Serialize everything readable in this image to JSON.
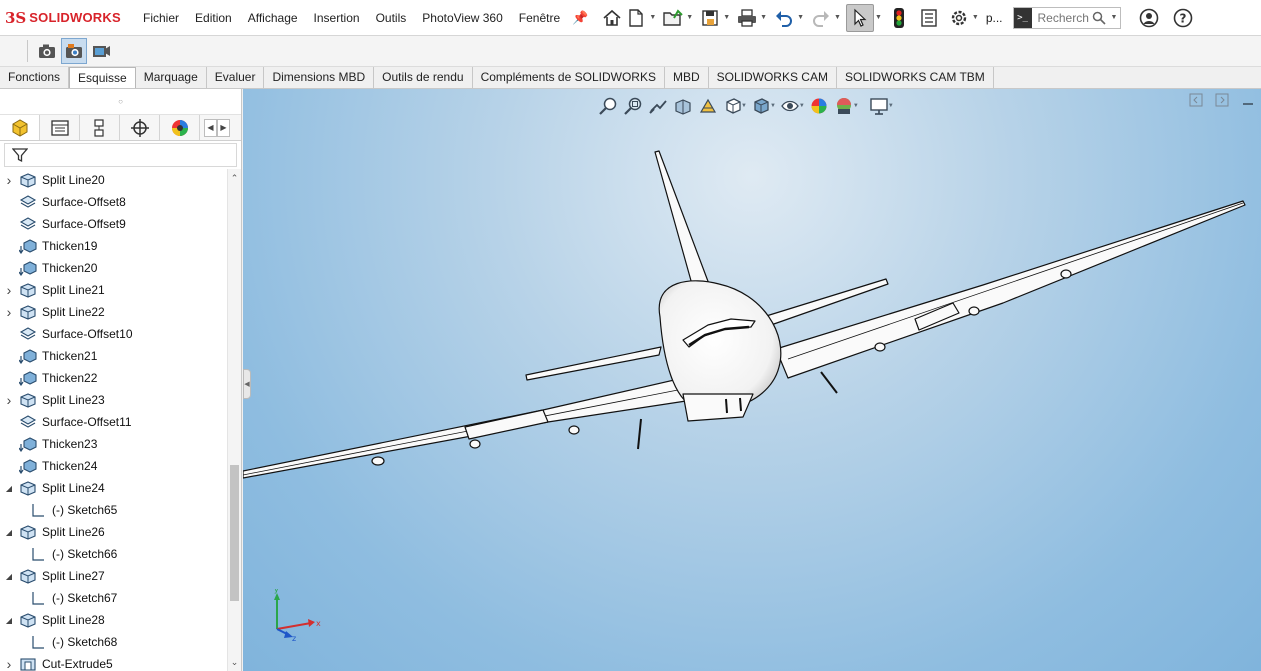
{
  "app": {
    "brand": "SOLIDWORKS",
    "brand_prefix": "3S"
  },
  "menu": [
    "Fichier",
    "Edition",
    "Affichage",
    "Insertion",
    "Outils",
    "PhotoView 360",
    "Fenêtre"
  ],
  "toolbar": {
    "icons": [
      "home-icon",
      "new-document-icon",
      "open-icon",
      "save-icon",
      "print-icon",
      "undo-icon",
      "redo-icon",
      "select-icon",
      "rebuild-icon",
      "file-properties-icon",
      "options-icon"
    ],
    "truncated_label": "p...",
    "search_placeholder": "Recherch"
  },
  "toolbar2": {
    "icons": [
      "camera-icon",
      "render-camera-icon",
      "scene-icon"
    ]
  },
  "tabs": [
    "Fonctions",
    "Esquisse",
    "Marquage",
    "Evaluer",
    "Dimensions MBD",
    "Outils de rendu",
    "Compléments de SOLIDWORKS",
    "MBD",
    "SOLIDWORKS CAM",
    "SOLIDWORKS CAM TBM"
  ],
  "active_tab": "Esquisse",
  "feature_tree": [
    {
      "label": "Split Line20",
      "type": "split",
      "expand": "collapsed"
    },
    {
      "label": "Surface-Offset8",
      "type": "surface",
      "expand": ""
    },
    {
      "label": "Surface-Offset9",
      "type": "surface",
      "expand": ""
    },
    {
      "label": "Thicken19",
      "type": "thicken",
      "expand": ""
    },
    {
      "label": "Thicken20",
      "type": "thicken",
      "expand": ""
    },
    {
      "label": "Split Line21",
      "type": "split",
      "expand": "collapsed"
    },
    {
      "label": "Split Line22",
      "type": "split",
      "expand": "collapsed"
    },
    {
      "label": "Surface-Offset10",
      "type": "surface",
      "expand": ""
    },
    {
      "label": "Thicken21",
      "type": "thicken",
      "expand": ""
    },
    {
      "label": "Thicken22",
      "type": "thicken",
      "expand": ""
    },
    {
      "label": "Split Line23",
      "type": "split",
      "expand": "collapsed"
    },
    {
      "label": "Surface-Offset11",
      "type": "surface",
      "expand": ""
    },
    {
      "label": "Thicken23",
      "type": "thicken",
      "expand": ""
    },
    {
      "label": "Thicken24",
      "type": "thicken",
      "expand": ""
    },
    {
      "label": "Split Line24",
      "type": "split",
      "expand": "expanded"
    },
    {
      "label": "(-) Sketch65",
      "type": "sketch",
      "expand": "child"
    },
    {
      "label": "Split Line26",
      "type": "split",
      "expand": "expanded"
    },
    {
      "label": "(-) Sketch66",
      "type": "sketch",
      "expand": "child"
    },
    {
      "label": "Split Line27",
      "type": "split",
      "expand": "expanded"
    },
    {
      "label": "(-) Sketch67",
      "type": "sketch",
      "expand": "child"
    },
    {
      "label": "Split Line28",
      "type": "split",
      "expand": "expanded"
    },
    {
      "label": "(-) Sketch68",
      "type": "sketch",
      "expand": "child"
    },
    {
      "label": "Cut-Extrude5",
      "type": "cut",
      "expand": "collapsed"
    }
  ],
  "triad": {
    "x": "x",
    "y": "y",
    "z": "z"
  },
  "colors": {
    "accent": "#d8232a",
    "sky_top": "#dfeaf3",
    "sky_bottom": "#80b4dc",
    "model": "#ffffff"
  }
}
